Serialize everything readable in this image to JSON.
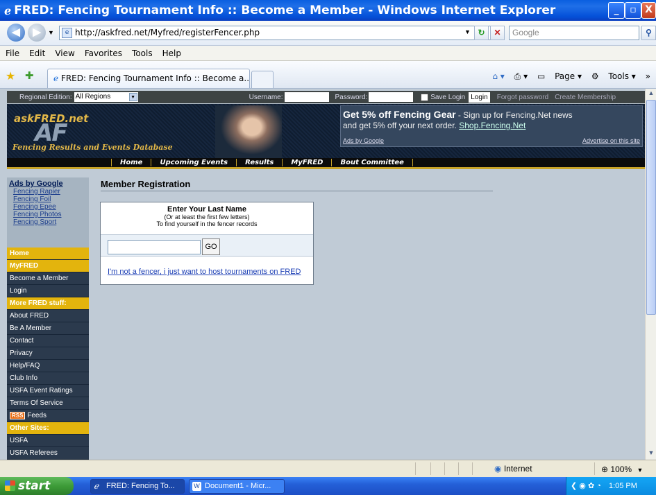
{
  "window": {
    "title": "FRED: Fencing Tournament Info :: Become a Member - Windows Internet Explorer",
    "minimize": "_",
    "maximize": "▫",
    "close": "X"
  },
  "address": {
    "url": "http://askfred.net/Myfred/registerFencer.php",
    "search_placeholder": "Google"
  },
  "menu": [
    "File",
    "Edit",
    "View",
    "Favorites",
    "Tools",
    "Help"
  ],
  "tabs": {
    "active": "FRED: Fencing Tournament Info :: Become a..."
  },
  "commandbar": {
    "page": "Page",
    "tools": "Tools"
  },
  "site_top": {
    "regional_label": "Regional Edition:",
    "region_value": "All Regions",
    "username_label": "Username:",
    "password_label": "Password:",
    "save_login": "Save Login",
    "login_btn": "Login",
    "forgot": "Forgot password",
    "create": "Create Membership"
  },
  "banner": {
    "logo_text": "askFRED.net",
    "logo_big": "AF",
    "tagline": "Fencing Results and Events Database",
    "ad_title": "Get 5% off Fencing Gear",
    "ad_title_rest": " - Sign up for Fencing.Net news",
    "ad_line2": "and get 5% off your next order. ",
    "ad_link": "Shop.Fencing.Net",
    "ads_by_google": "Ads by Google",
    "advertise": "Advertise on this site"
  },
  "nav": [
    "Home",
    "Upcoming Events",
    "Results",
    "MyFRED",
    "Bout Committee"
  ],
  "left_ads": {
    "title": "Ads by Google",
    "links": [
      "Fencing Rapier",
      "Fencing Foil",
      "Fencing Epee",
      "Fencing Photos",
      "Fencing Sport"
    ]
  },
  "left_nav": [
    {
      "label": "Home",
      "style": "gold"
    },
    {
      "label": "MyFRED",
      "style": "gold"
    },
    {
      "label": "Become a Member",
      "style": "dark"
    },
    {
      "label": "Login",
      "style": "dark"
    },
    {
      "label": "More FRED stuff:",
      "style": "gold"
    },
    {
      "label": "About FRED",
      "style": "dark"
    },
    {
      "label": "Be A Member",
      "style": "dark"
    },
    {
      "label": "Contact",
      "style": "dark"
    },
    {
      "label": "Privacy",
      "style": "dark"
    },
    {
      "label": "Help/FAQ",
      "style": "dark"
    },
    {
      "label": "Club Info",
      "style": "dark"
    },
    {
      "label": "USFA Event Ratings",
      "style": "dark"
    },
    {
      "label": "Terms Of Service",
      "style": "dark"
    },
    {
      "label": "Feeds",
      "style": "dark",
      "badge": "RSS"
    },
    {
      "label": "Other Sites:",
      "style": "gold"
    },
    {
      "label": "USFA",
      "style": "dark"
    },
    {
      "label": "USFA Referees",
      "style": "dark"
    }
  ],
  "main": {
    "heading": "Member Registration",
    "box_title": "Enter Your Last Name",
    "box_sub1": "(Or at least the first few letters)",
    "box_sub2": "To find yourself in the fencer records",
    "lastname_value": "",
    "go": "GO",
    "host_link": "I'm not a fencer, i just want to host tournaments on FRED"
  },
  "status": {
    "zone": "Internet",
    "zoom": "100%"
  },
  "taskbar": {
    "start": "start",
    "tasks": [
      "FRED: Fencing To...",
      "Document1 - Micr..."
    ],
    "time": "1:05 PM"
  }
}
